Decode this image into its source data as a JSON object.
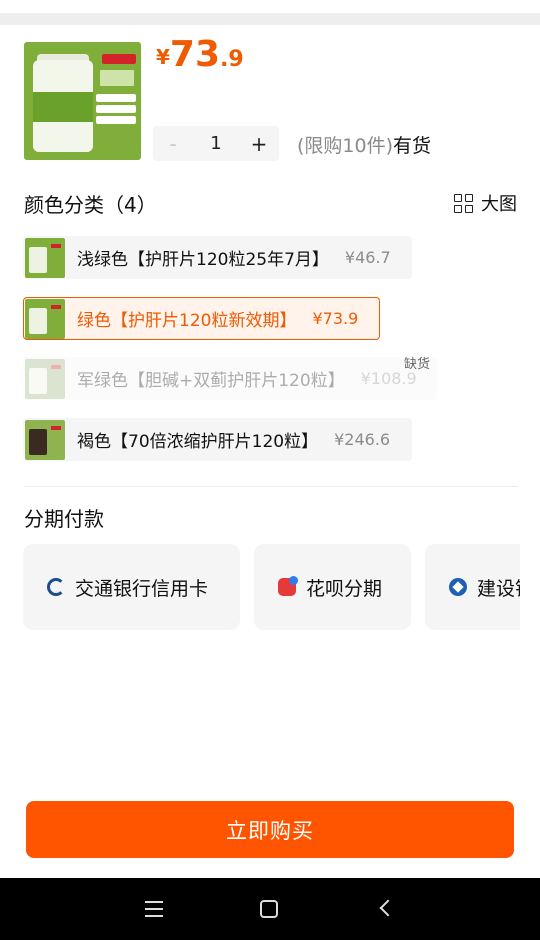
{
  "product": {
    "price_symbol": "¥",
    "price_integer": "73",
    "price_decimal": ".9",
    "quantity": "1",
    "minus_label": "-",
    "plus_label": "+",
    "limit_text": "(限购10件)",
    "stock_text": "有货"
  },
  "color_section": {
    "title": "颜色分类（4）",
    "big_view_label": "大图",
    "options": [
      {
        "label": "浅绿色【护肝片120粒25年7月】",
        "price": "¥46.7",
        "state": "normal"
      },
      {
        "label": "绿色【护肝片120粒新效期】",
        "price": "¥73.9",
        "state": "selected"
      },
      {
        "label": "军绿色【胆碱+双蓟护肝片120粒】",
        "price": "¥108.9",
        "state": "disabled",
        "badge": "缺货"
      },
      {
        "label": "褐色【70倍浓缩护肝片120粒】",
        "price": "¥246.6",
        "state": "normal"
      }
    ]
  },
  "installment": {
    "title": "分期付款",
    "methods": [
      {
        "label": "交通银行信用卡",
        "icon": "bocom-icon"
      },
      {
        "label": "花呗分期",
        "icon": "huabei-icon"
      },
      {
        "label": "建设银行信用卡",
        "icon": "ccb-icon"
      }
    ]
  },
  "buy_button": {
    "label": "立即购买"
  },
  "colors": {
    "accent": "#f05a00",
    "buy": "#ff5500"
  }
}
